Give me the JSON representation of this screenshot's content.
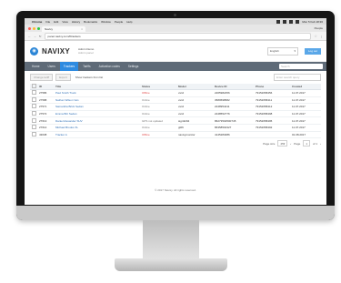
{
  "menubar": {
    "app": "Chrome",
    "items": [
      "File",
      "Edit",
      "View",
      "History",
      "Bookmarks",
      "Window",
      "People",
      "Help"
    ],
    "clock": "Mon 5 Feb 18:36"
  },
  "browser": {
    "tab_title": "Navixy",
    "user": "People",
    "url": "panel.navixy.com/#trackers"
  },
  "header": {
    "brand": "NAVIXY",
    "account_name": "Admin Demo",
    "account_sub": "Admin panel",
    "language": "English",
    "logout": "Log out"
  },
  "nav": {
    "items": [
      "Home",
      "Users",
      "Trackers",
      "Tariffs",
      "Activation codes",
      "Settings"
    ],
    "active": "Trackers",
    "search_placeholder": "Search"
  },
  "toolbar": {
    "btn1": "Change tariff",
    "btn2": "Export",
    "label": "Show trackers from list",
    "search_placeholder": "Enter search query"
  },
  "table": {
    "headers": [
      "",
      "ID",
      "Title",
      "Status",
      "Model",
      "Device ID",
      "Phone",
      "Created"
    ],
    "rows": [
      {
        "id": "27586",
        "title": "Paul Smith Truck",
        "status": "Offline",
        "model": "vsrcl",
        "device": "2265982456",
        "phone": "79152658456",
        "created": "11.07.2017"
      },
      {
        "id": "27588",
        "title": "Nathan Wilson Van",
        "status": "Online",
        "model": "vsrcl",
        "device": "3589598582",
        "phone": "79152658411",
        "created": "11.07.2017"
      },
      {
        "id": "27571",
        "title": "Samantha Brick Sedan",
        "status": "Online",
        "model": "vsrcl",
        "device": "2248954211",
        "phone": "79152658412",
        "created": "11.07.2017"
      },
      {
        "id": "27572",
        "title": "Emma Brit Sedan",
        "status": "Online",
        "model": "vsrcl",
        "device": "2248552776",
        "phone": "79152658498",
        "created": "11.07.2017"
      },
      {
        "id": "27613",
        "title": "Daniel Alexander SUV",
        "status": "GPS not updated",
        "model": "sign3204",
        "device": "86273502500745",
        "phone": "79152658495",
        "created": "11.07.2017"
      },
      {
        "id": "27614",
        "title": "Michael Brooks XL",
        "status": "Online",
        "model": "gt06",
        "device": "86358502327",
        "phone": "79152658492",
        "created": "11.07.2017"
      },
      {
        "id": "43038",
        "title": "Tracker A",
        "status": "Offline",
        "model": "navixymonitor",
        "device": "4145284086",
        "phone": "",
        "created": "01.08.2017"
      }
    ]
  },
  "pager": {
    "label": "Page size",
    "size": "25",
    "page_label": "Page",
    "page": "1",
    "of": "of 1"
  },
  "footer": "© 2017 Navixy. All rights reserved."
}
